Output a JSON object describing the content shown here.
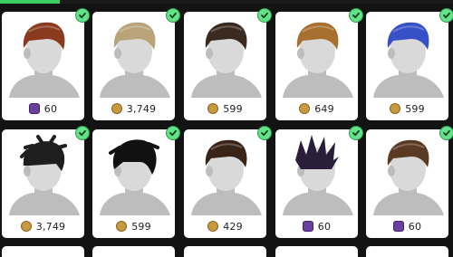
{
  "colors": {
    "background": "#131313",
    "accent_tab": "#3ccf64",
    "owned_check": "#63e28a",
    "coin_gold": "#c89a3e",
    "coin_premium": "#6b3fa0"
  },
  "items": [
    {
      "hair_color": "#8a3a1e",
      "currency": "premium",
      "price": "60"
    },
    {
      "hair_color": "#b9a47a",
      "currency": "coins",
      "price": "3,749"
    },
    {
      "hair_color": "#3b2a20",
      "currency": "coins",
      "price": "599"
    },
    {
      "hair_color": "#a8702e",
      "currency": "coins",
      "price": "649"
    },
    {
      "hair_color": "#3650c8",
      "currency": "coins",
      "price": "599"
    },
    {
      "hair_color": "#1e1e1e",
      "currency": "coins",
      "price": "3,749"
    },
    {
      "hair_color": "#111111",
      "currency": "coins",
      "price": "599"
    },
    {
      "hair_color": "#3a2418",
      "currency": "coins",
      "price": "429"
    },
    {
      "hair_color": "#2a1f3a",
      "currency": "premium",
      "price": "60"
    },
    {
      "hair_color": "#5a3a22",
      "currency": "premium",
      "price": "60"
    }
  ]
}
